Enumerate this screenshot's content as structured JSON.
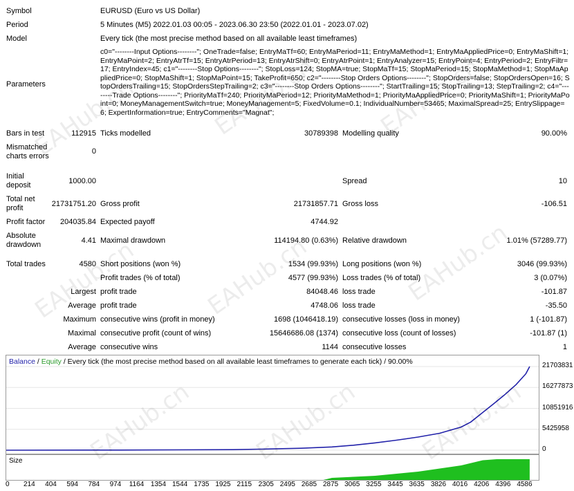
{
  "header": {
    "symbol": {
      "label": "Symbol",
      "value": "EURUSD (Euro vs US Dollar)"
    },
    "period": {
      "label": "Period",
      "value": "5 Minutes (M5) 2022.01.03 00:05 - 2023.06.30 23:50 (2022.01.01 - 2023.07.02)"
    },
    "model": {
      "label": "Model",
      "value": "Every tick (the most precise method based on all available least timeframes)"
    },
    "parameters": {
      "label": "Parameters",
      "value": "c0=\"--------Input Options--------\"; OneTrade=false; EntryMaTf=60; EntryMaPeriod=11; EntryMaMethod=1; EntryMaAppliedPrice=0; EntryMaShift=1; EntryMaPoint=2; EntryAtrTf=15; EntryAtrPeriod=13; EntryAtrShift=0; EntryAtrPoint=1; EntryAnalyzer=15; EntryPoint=4; EntryPeriod=2; EntryFiltr=17; EntryIndex=45; c1=\"--------Stop Options--------\"; StopLoss=124; StopMA=true; StopMaTf=15; StopMaPeriod=15; StopMaMethod=1; StopMaAppliedPrice=0; StopMaShift=1; StopMaPoint=15; TakeProfit=650; c2=\"--------Stop Orders Options--------\"; StopOrders=false; StopOrdersOpen=16; StopOrdersTrailing=15; StopOrdersStepTrailing=2; c3=\"--------Stop Orders Options--------\"; StartTrailing=15; StopTrailing=13; StepTrailing=2; c4=\"--------Trade Options--------\"; PriorityMaTf=240; PriorityMaPeriod=12; PriorityMaMethod=1; PriorityMaAppliedPrice=0; PriorityMaShift=1; PriorityMaPoint=0; MoneyManagementSwitch=true; MoneyManagement=5; FixedVolume=0.1; IndividualNumber=53465; MaximalSpread=25; EntrySlippage=6; ExpertInformation=true; EntryComments=\"Magnat\";"
    }
  },
  "stats": {
    "bars_label": "Bars in test",
    "bars_value": "112915",
    "ticks_label": "Ticks modelled",
    "ticks_value": "30789398",
    "quality_label": "Modelling quality",
    "quality_value": "90.00%",
    "mismatch_label1": "Mismatched",
    "mismatch_label2": "charts errors",
    "mismatch_value": "0",
    "deposit_label1": "Initial",
    "deposit_label2": "deposit",
    "deposit_value": "1000.00",
    "spread_label": "Spread",
    "spread_value": "10",
    "net_label1": "Total net",
    "net_label2": "profit",
    "net_value": "21731751.20",
    "gross_profit_label": "Gross profit",
    "gross_profit_value": "21731857.71",
    "gross_loss_label": "Gross loss",
    "gross_loss_value": "-106.51",
    "pf_label": "Profit factor",
    "pf_value": "204035.84",
    "ep_label": "Expected payoff",
    "ep_value": "4744.92",
    "abs_label1": "Absolute",
    "abs_label2": "drawdown",
    "abs_value": "4.41",
    "maxdd_label": "Maximal drawdown",
    "maxdd_value": "114194.80 (0.63%)",
    "reldd_label": "Relative drawdown",
    "reldd_value": "1.01% (57289.77)",
    "tt_label": "Total trades",
    "tt_value": "4580",
    "short_label": "Short positions (won %)",
    "short_value": "1534 (99.93%)",
    "long_label": "Long positions (won %)",
    "long_value": "3046 (99.93%)",
    "pt_label": "Profit trades (% of total)",
    "pt_value": "4577 (99.93%)",
    "lt_label": "Loss trades (% of total)",
    "lt_value": "3 (0.07%)",
    "largest_label": "Largest",
    "lpt_label": "profit trade",
    "lpt_value": "84048.46",
    "llt_label": "loss trade",
    "llt_value": "-101.87",
    "average_label": "Average",
    "apt_label": "profit trade",
    "apt_value": "4748.06",
    "alt_label": "loss trade",
    "alt_value": "-35.50",
    "maximum_label": "Maximum",
    "mcw_label": "consecutive wins (profit in money)",
    "mcw_value": "1698 (1046418.19)",
    "mcl_label": "consecutive losses (loss in money)",
    "mcl_value": "1 (-101.87)",
    "maximal_label": "Maximal",
    "mcp_label": "consecutive profit (count of wins)",
    "mcp_value": "15646686.08 (1374)",
    "mcll_label": "consecutive loss (count of losses)",
    "mcll_value": "-101.87 (1)",
    "average2_label": "Average",
    "acw_label": "consecutive wins",
    "acw_value": "1144",
    "acl_label": "consecutive losses",
    "acl_value": "1"
  },
  "watermark": "EAHub.cn",
  "chart_legend": {
    "balance": "Balance",
    "sep1": " / ",
    "equity": "Equity",
    "rest": " / Every tick (the most precise method based on all available least timeframes to generate each tick) / 90.00%"
  },
  "size_label": "Size",
  "colors": {
    "balance": "#2222aa",
    "volume": "#1fbf1f"
  },
  "chart_data": {
    "type": "line",
    "x_ticks": [
      "0",
      "214",
      "404",
      "594",
      "784",
      "974",
      "1164",
      "1354",
      "1544",
      "1735",
      "1925",
      "2115",
      "2305",
      "2495",
      "2685",
      "2875",
      "3065",
      "3255",
      "3445",
      "3635",
      "3826",
      "4016",
      "4206",
      "4396",
      "4586"
    ],
    "y_ticks": [
      "21703831",
      "16277873",
      "10851916",
      "5425958",
      "0"
    ],
    "ylim": [
      0,
      21703831
    ],
    "xlim": [
      0,
      4700
    ],
    "series": [
      {
        "x": [
          0,
          1000,
          2000,
          2300,
          2600,
          2875,
          3065,
          3255,
          3445,
          3635,
          3826,
          4016,
          4100,
          4206,
          4300,
          4396,
          4500,
          4586,
          4620
        ],
        "y": [
          1000,
          40000,
          150000,
          300000,
          500000,
          850000,
          1300000,
          1900000,
          2600000,
          3400000,
          4400000,
          6000000,
          7300000,
          9800000,
          12000000,
          14300000,
          17000000,
          19800000,
          21703831
        ]
      }
    ],
    "volume": {
      "x": [
        0,
        2800,
        2875,
        3065,
        3255,
        3445,
        3635,
        3826,
        4016,
        4206,
        4330,
        4620
      ],
      "y": [
        0,
        0,
        0.1,
        0.15,
        0.2,
        0.3,
        0.4,
        0.55,
        0.7,
        0.95,
        1,
        1
      ]
    }
  }
}
